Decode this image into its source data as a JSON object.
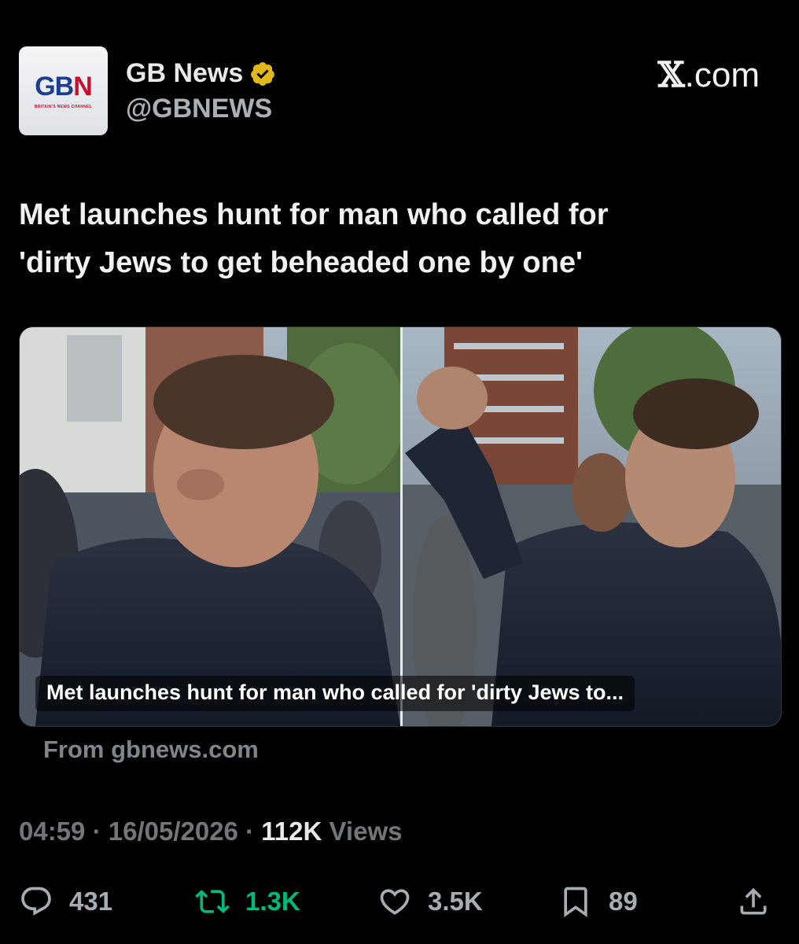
{
  "account": {
    "avatar_logo_main": "GB",
    "avatar_logo_accent": "N",
    "avatar_tagline": "BRITAIN'S NEWS CHANNEL",
    "name": "GB News",
    "handle": "@GBNEWS",
    "verified_icon": "verified-badge-icon"
  },
  "site_brand": {
    "mark": "𝕏",
    "suffix": ".com"
  },
  "tweet": {
    "headline_line1": "Met launches hunt for man who called for",
    "headline_line2": "'dirty Jews to get beheaded one by one'",
    "card_caption": "Met launches hunt for man who called for 'dirty Jews to...",
    "card_source": "From gbnews.com",
    "time": "04:59",
    "separator": "·",
    "date": "16/05/2026",
    "views_count": "112K",
    "views_label": "Views"
  },
  "actions": [
    {
      "icon": "reply-icon",
      "count": "431"
    },
    {
      "icon": "retweet-icon",
      "count": "1.3K",
      "color": "#00ba7c"
    },
    {
      "icon": "like-icon",
      "count": "3.5K"
    },
    {
      "icon": "bookmark-icon",
      "count": "89"
    },
    {
      "icon": "share-icon",
      "count": ""
    }
  ],
  "colors": {
    "background": "#000000",
    "text": "#e7e9ea",
    "muted": "#71767b",
    "retweet_green": "#00ba7c",
    "verified_gold": "#e2b719"
  }
}
